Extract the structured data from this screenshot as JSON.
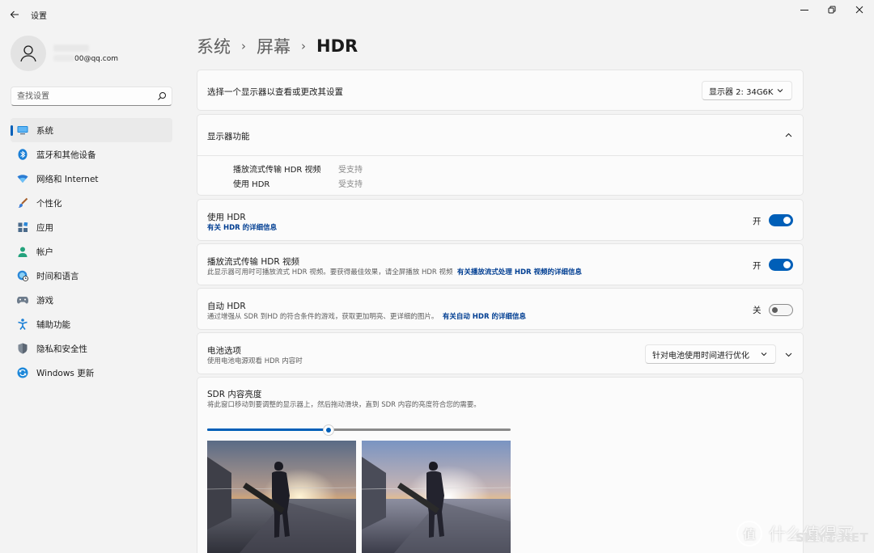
{
  "window": {
    "title": "设置"
  },
  "profile": {
    "email_visible": "@qq.com",
    "email_suffix_digits": "00"
  },
  "search": {
    "placeholder": "查找设置"
  },
  "nav": {
    "items": [
      {
        "label": "系统",
        "icon": "monitor-icon",
        "active": true
      },
      {
        "label": "蓝牙和其他设备",
        "icon": "bluetooth-icon"
      },
      {
        "label": "网络和 Internet",
        "icon": "wifi-icon"
      },
      {
        "label": "个性化",
        "icon": "brush-icon"
      },
      {
        "label": "应用",
        "icon": "apps-icon"
      },
      {
        "label": "帐户",
        "icon": "person-icon"
      },
      {
        "label": "时间和语言",
        "icon": "globe-clock-icon"
      },
      {
        "label": "游戏",
        "icon": "gamepad-icon"
      },
      {
        "label": "辅助功能",
        "icon": "accessibility-icon"
      },
      {
        "label": "隐私和安全性",
        "icon": "shield-icon"
      },
      {
        "label": "Windows 更新",
        "icon": "update-icon"
      }
    ]
  },
  "breadcrumb": {
    "items": [
      "系统",
      "屏幕",
      "HDR"
    ]
  },
  "display_select": {
    "label": "选择一个显示器以查看或更改其设置",
    "value": "显示器 2: 34G6K"
  },
  "capabilities": {
    "title": "显示器功能",
    "rows": [
      {
        "name": "播放流式传输 HDR 视频",
        "value": "受支持"
      },
      {
        "name": "使用 HDR",
        "value": "受支持"
      }
    ]
  },
  "use_hdr": {
    "title": "使用 HDR",
    "link": "有关 HDR 的详细信息",
    "state_label": "开",
    "on": true
  },
  "stream_hdr": {
    "title": "播放流式传输 HDR 视频",
    "desc": "此显示器可用时可播放流式 HDR 视频。要获得最佳效果，请全屏播放 HDR 视频",
    "link": "有关播放流式处理 HDR 视频的详细信息",
    "state_label": "开",
    "on": true
  },
  "auto_hdr": {
    "title": "自动 HDR",
    "desc": "通过增强从 SDR 到HD 的符合条件的游戏，获取更加明亮、更详细的图片。",
    "link": "有关自动 HDR 的详细信息",
    "state_label": "关",
    "on": false
  },
  "battery": {
    "title": "电池选项",
    "desc": "使用电池电源观看 HDR 内容时",
    "value": "针对电池使用时间进行优化"
  },
  "sdr": {
    "title": "SDR 内容亮度",
    "desc": "将此窗口移动到要调整的显示器上，然后拖动滑块，直到 SDR 内容的亮度符合您的需要。",
    "slider_value": 40
  },
  "watermark": {
    "logo_char": "值",
    "text": "什么值得买",
    "brand": "SMYZ.NET"
  },
  "colors": {
    "accent": "#005fb8",
    "link": "#003e92",
    "background": "#f3f3f3",
    "card": "#fbfbfb"
  }
}
